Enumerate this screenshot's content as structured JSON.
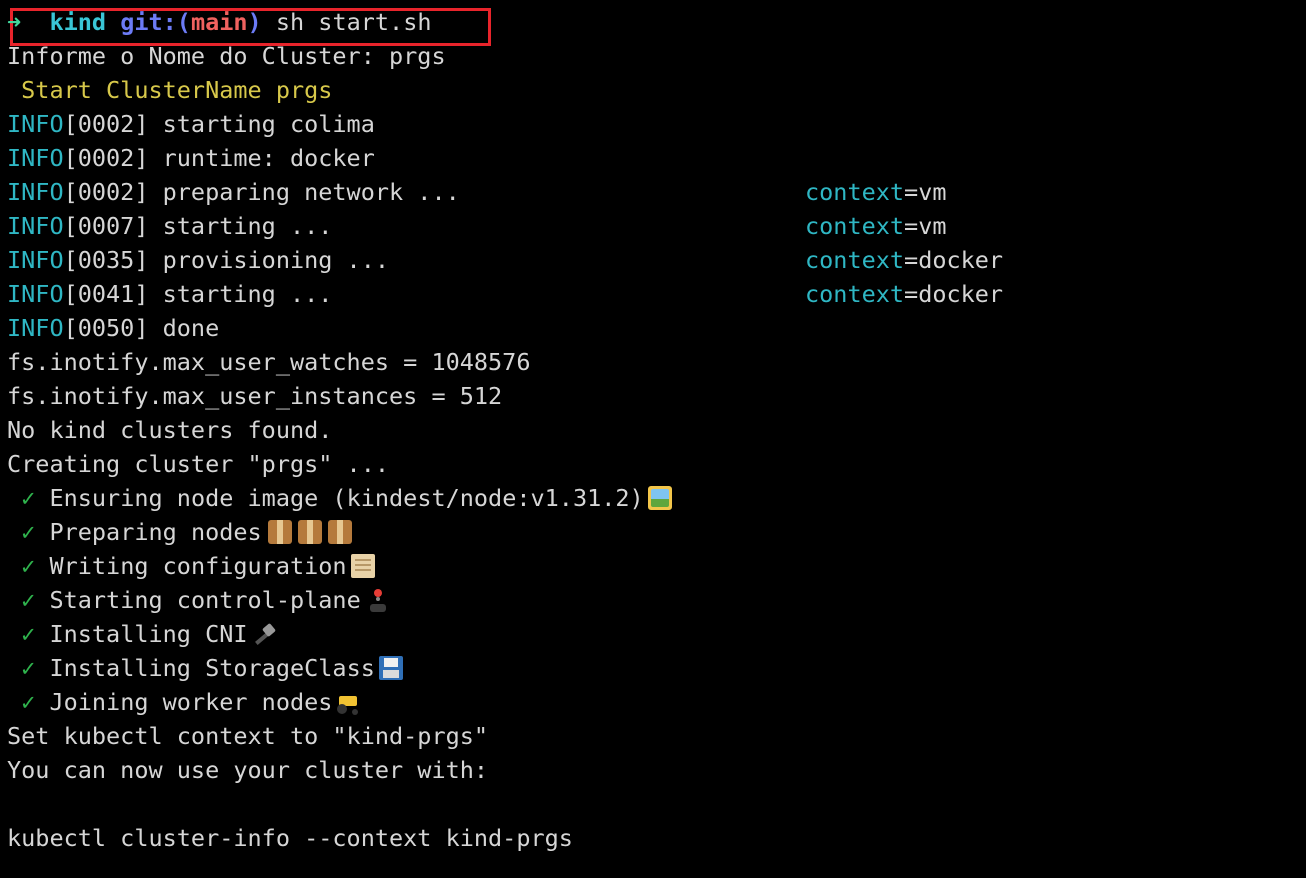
{
  "prompt": {
    "arrow": "➜",
    "directory": "kind",
    "git_prefix": "git:(",
    "branch": "main",
    "git_suffix": ")",
    "command": "sh start.sh"
  },
  "lines": {
    "cluster_prompt": "Informe o Nome do Cluster: prgs",
    "start_cluster": " Start ClusterName prgs",
    "info": [
      {
        "level": "INFO",
        "time": "[0002]",
        "message": " starting colima",
        "ctx_key": "",
        "ctx_val": ""
      },
      {
        "level": "INFO",
        "time": "[0002]",
        "message": " runtime: docker",
        "ctx_key": "",
        "ctx_val": ""
      },
      {
        "level": "INFO",
        "time": "[0002]",
        "message": " preparing network ...",
        "ctx_key": "context",
        "ctx_val": "=vm"
      },
      {
        "level": "INFO",
        "time": "[0007]",
        "message": " starting ...",
        "ctx_key": "context",
        "ctx_val": "=vm"
      },
      {
        "level": "INFO",
        "time": "[0035]",
        "message": " provisioning ...",
        "ctx_key": "context",
        "ctx_val": "=docker"
      },
      {
        "level": "INFO",
        "time": "[0041]",
        "message": " starting ...",
        "ctx_key": "context",
        "ctx_val": "=docker"
      },
      {
        "level": "INFO",
        "time": "[0050]",
        "message": " done",
        "ctx_key": "",
        "ctx_val": ""
      }
    ],
    "max_user_watches": "fs.inotify.max_user_watches = 1048576",
    "max_user_instances": "fs.inotify.max_user_instances = 512",
    "no_clusters": "No kind clusters found.",
    "creating": "Creating cluster \"prgs\" ...",
    "steps": [
      {
        "check": "✓",
        "text": " Ensuring node image (kindest/node:v1.31.2)",
        "icon": "framed-picture-emoji"
      },
      {
        "check": "✓",
        "text": " Preparing nodes",
        "icon": "package-emoji"
      },
      {
        "check": "✓",
        "text": " Writing configuration",
        "icon": "scroll-emoji"
      },
      {
        "check": "✓",
        "text": " Starting control-plane",
        "icon": "joystick-emoji"
      },
      {
        "check": "✓",
        "text": " Installing CNI",
        "icon": "electric-plug-emoji"
      },
      {
        "check": "✓",
        "text": " Installing StorageClass",
        "icon": "floppy-disk-emoji"
      },
      {
        "check": "✓",
        "text": " Joining worker nodes",
        "icon": "tractor-emoji"
      }
    ],
    "set_context": "Set kubectl context to \"kind-prgs\"",
    "use_cluster": "You can now use your cluster with:",
    "kubectl_cmd": "kubectl cluster-info --context kind-prgs"
  },
  "colors": {
    "background": "#000000",
    "text": "#d6d6d6",
    "highlight_box": "#e8242b",
    "info": "#2fb7c4",
    "start_line": "#d7c84a",
    "check": "#2fb34d"
  }
}
